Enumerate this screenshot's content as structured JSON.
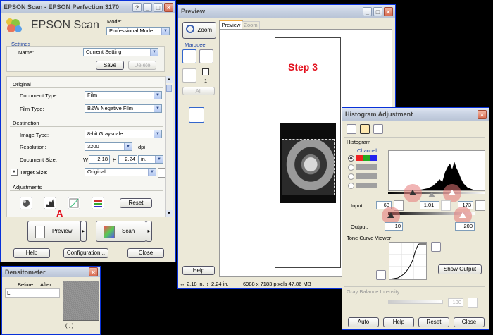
{
  "epson": {
    "title": "EPSON Scan - EPSON Perfection 3170",
    "logo": "EPSON Scan",
    "mode_label": "Mode:",
    "mode_value": "Professional Mode",
    "settings_label": "Settings",
    "name_label": "Name:",
    "name_value": "Current Setting",
    "save": "Save",
    "delete": "Delete",
    "original_label": "Original",
    "doc_type_label": "Document Type:",
    "doc_type_value": "Film",
    "film_type_label": "Film Type:",
    "film_type_value": "B&W Negative Film",
    "destination_label": "Destination",
    "image_type_label": "Image Type:",
    "image_type_value": "8-bit Grayscale",
    "resolution_label": "Resolution:",
    "resolution_value": "3200",
    "dpi": "dpi",
    "doc_size_label": "Document Size:",
    "w_label": "W",
    "w_value": "2.18",
    "h_label": "H",
    "h_value": "2.24",
    "unit_value": "in.",
    "target_size_label": "Target Size:",
    "target_size_value": "Original",
    "adjustments_label": "Adjustments",
    "reset": "Reset",
    "marker_a": "A",
    "preview": "Preview",
    "scan": "Scan",
    "help": "Help",
    "configuration": "Configuration...",
    "close": "Close"
  },
  "densitometer": {
    "title": "Densitometer",
    "before": "Before",
    "after": "After",
    "l": "L",
    "paren": "(        ,        )"
  },
  "preview": {
    "title": "Preview",
    "zoom_button": "Zoom",
    "tab_preview": "Preview",
    "tab_zoom": "Zoom",
    "marquee": "Marquee",
    "marquee_count": "1",
    "all": "All",
    "step": "Step 3",
    "help": "Help",
    "status_w": "2.18 in.",
    "status_h": "2.24 in.",
    "status_info": "6988 x 7183 pixels 47.86 MB"
  },
  "histogram": {
    "title": "Histogram Adjustment",
    "histogram_label": "Histogram",
    "channel_label": "Channel",
    "input_label": "Input:",
    "input_shadow": "63",
    "input_gamma": "1.01",
    "input_highlight": "173",
    "output_label": "Output:",
    "output_shadow": "10",
    "output_highlight": "200",
    "tone_curve_label": "Tone Curve Viewer",
    "show_output": "Show Output",
    "gray_balance_label": "Gray Balance Intensity",
    "gray_value": "100",
    "auto": "Auto",
    "help": "Help",
    "reset": "Reset",
    "close": "Close"
  },
  "colors": {
    "accent_red": "#e3101d",
    "xp_blue": "#0831d9"
  }
}
